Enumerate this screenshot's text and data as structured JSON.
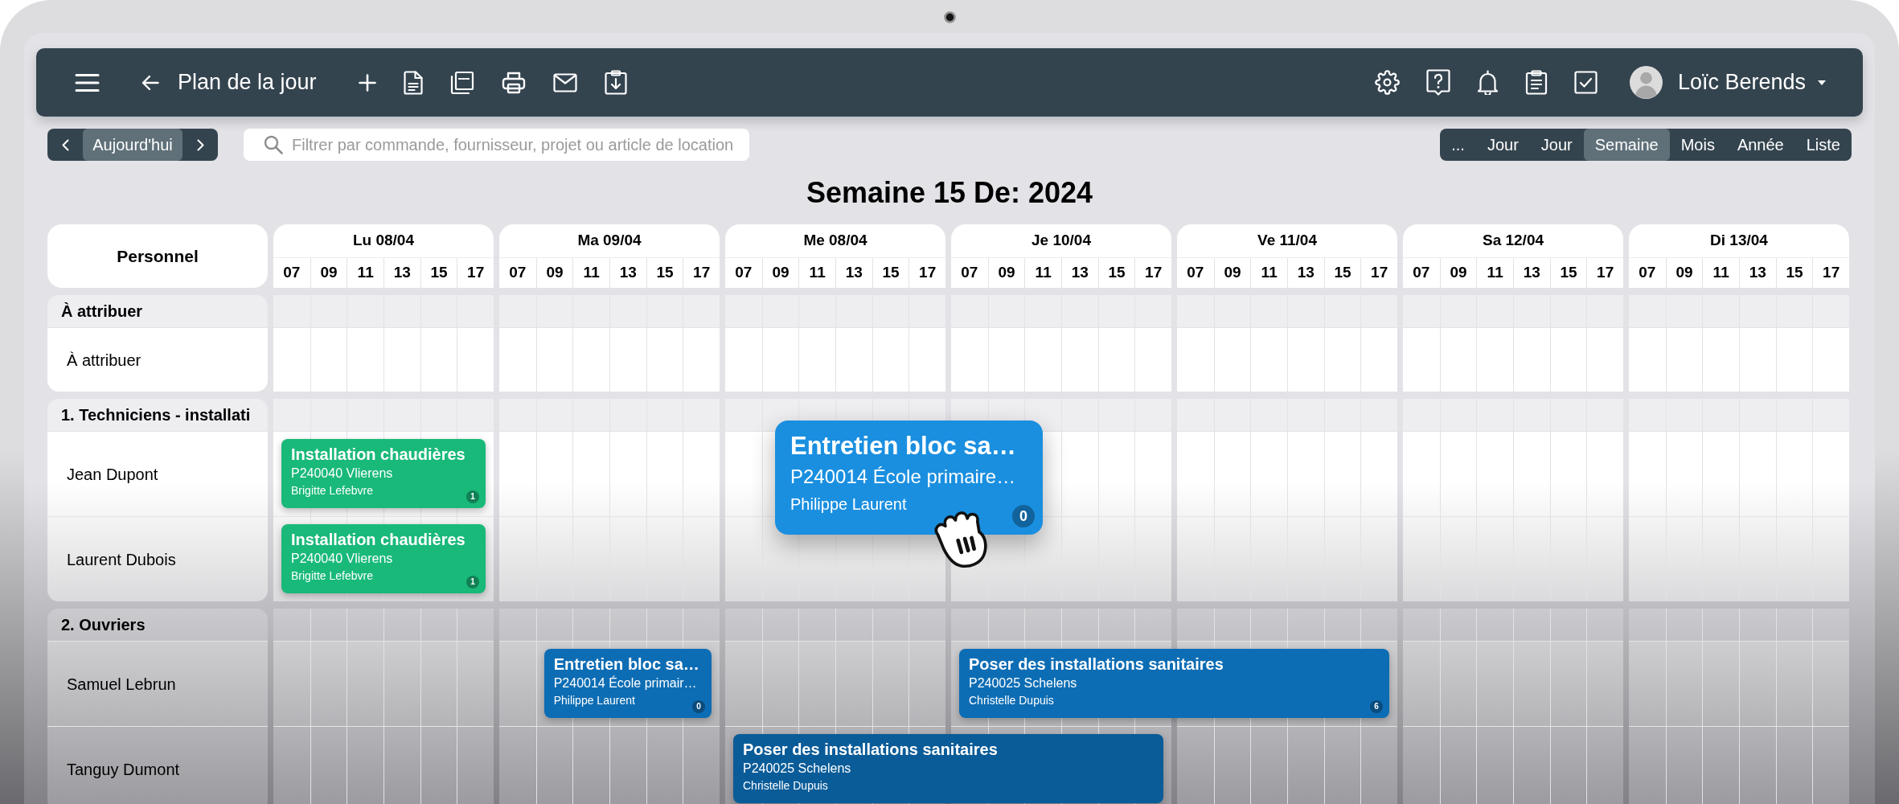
{
  "app_bar": {
    "title": "Plan de la jour",
    "user_name": "Loïc Berends"
  },
  "date_nav": {
    "today_label": "Aujourd'hui"
  },
  "search": {
    "placeholder": "Filtrer par commande, fournisseur, projet ou article de location"
  },
  "view_tabs": [
    {
      "label": "...",
      "selected": false
    },
    {
      "label": "Jour",
      "selected": false
    },
    {
      "label": "Jour",
      "selected": false
    },
    {
      "label": "Semaine",
      "selected": true
    },
    {
      "label": "Mois",
      "selected": false
    },
    {
      "label": "Année",
      "selected": false
    },
    {
      "label": "Liste",
      "selected": false
    }
  ],
  "schedule": {
    "title": "Semaine 15 De: 2024",
    "resource_heading": "Personnel",
    "days": [
      {
        "label": "Lu 08/04",
        "hours": [
          "07",
          "09",
          "11",
          "13",
          "15",
          "17"
        ]
      },
      {
        "label": "Ma 09/04",
        "hours": [
          "07",
          "09",
          "11",
          "13",
          "15",
          "17"
        ]
      },
      {
        "label": "Me 08/04",
        "hours": [
          "07",
          "09",
          "11",
          "13",
          "15",
          "17"
        ]
      },
      {
        "label": "Je 10/04",
        "hours": [
          "07",
          "09",
          "11",
          "13",
          "15",
          "17"
        ]
      },
      {
        "label": "Ve 11/04",
        "hours": [
          "07",
          "09",
          "11",
          "13",
          "15",
          "17"
        ]
      },
      {
        "label": "Sa 12/04",
        "hours": [
          "07",
          "09",
          "11",
          "13",
          "15",
          "17"
        ]
      },
      {
        "label": "Di 13/04",
        "hours": [
          "07",
          "09",
          "11",
          "13",
          "15",
          "17"
        ]
      }
    ],
    "groups": [
      {
        "label": "À attribuer",
        "rows": [
          {
            "name": "À attribuer"
          }
        ]
      },
      {
        "label": "1. Techniciens - installati",
        "rows": [
          {
            "name": "Jean Dupont",
            "events": [
              {
                "title": "Installation chaudières",
                "project": "P240040 Vlierens",
                "contact": "Brigitte Lefebvre",
                "count": "1",
                "color": "#19b97a"
              }
            ]
          },
          {
            "name": "Laurent Dubois",
            "events": [
              {
                "title": "Installation chaudières",
                "project": "P240040 Vlierens",
                "contact": "Brigitte Lefebvre",
                "count": "1",
                "color": "#19b97a"
              }
            ]
          }
        ]
      },
      {
        "label": "2. Ouvriers",
        "rows": [
          {
            "name": "Samuel Lebrun",
            "events": [
              {
                "title": "Entretien bloc sa…",
                "project": "P240014 École primair…",
                "contact": "Philippe Laurent",
                "count": "0",
                "color": "#0d6db4"
              },
              {
                "title": "Poser des installations sanitaires",
                "project": "P240025 Schelens",
                "contact": "Christelle Dupuis",
                "count": "6",
                "color": "#0d6db4"
              }
            ]
          },
          {
            "name": "Tanguy Dumont",
            "events": [
              {
                "title": "Poser des installations sanitaires",
                "project": "P240025 Schelens",
                "contact": "Christelle Dupuis",
                "color": "#0a5c98"
              }
            ]
          }
        ]
      }
    ]
  },
  "dragged_event": {
    "title": "Entretien bloc sa…",
    "project": "P240014 École primaire…",
    "contact": "Philippe Laurent",
    "count": "0",
    "color": "#1a8fe0"
  }
}
